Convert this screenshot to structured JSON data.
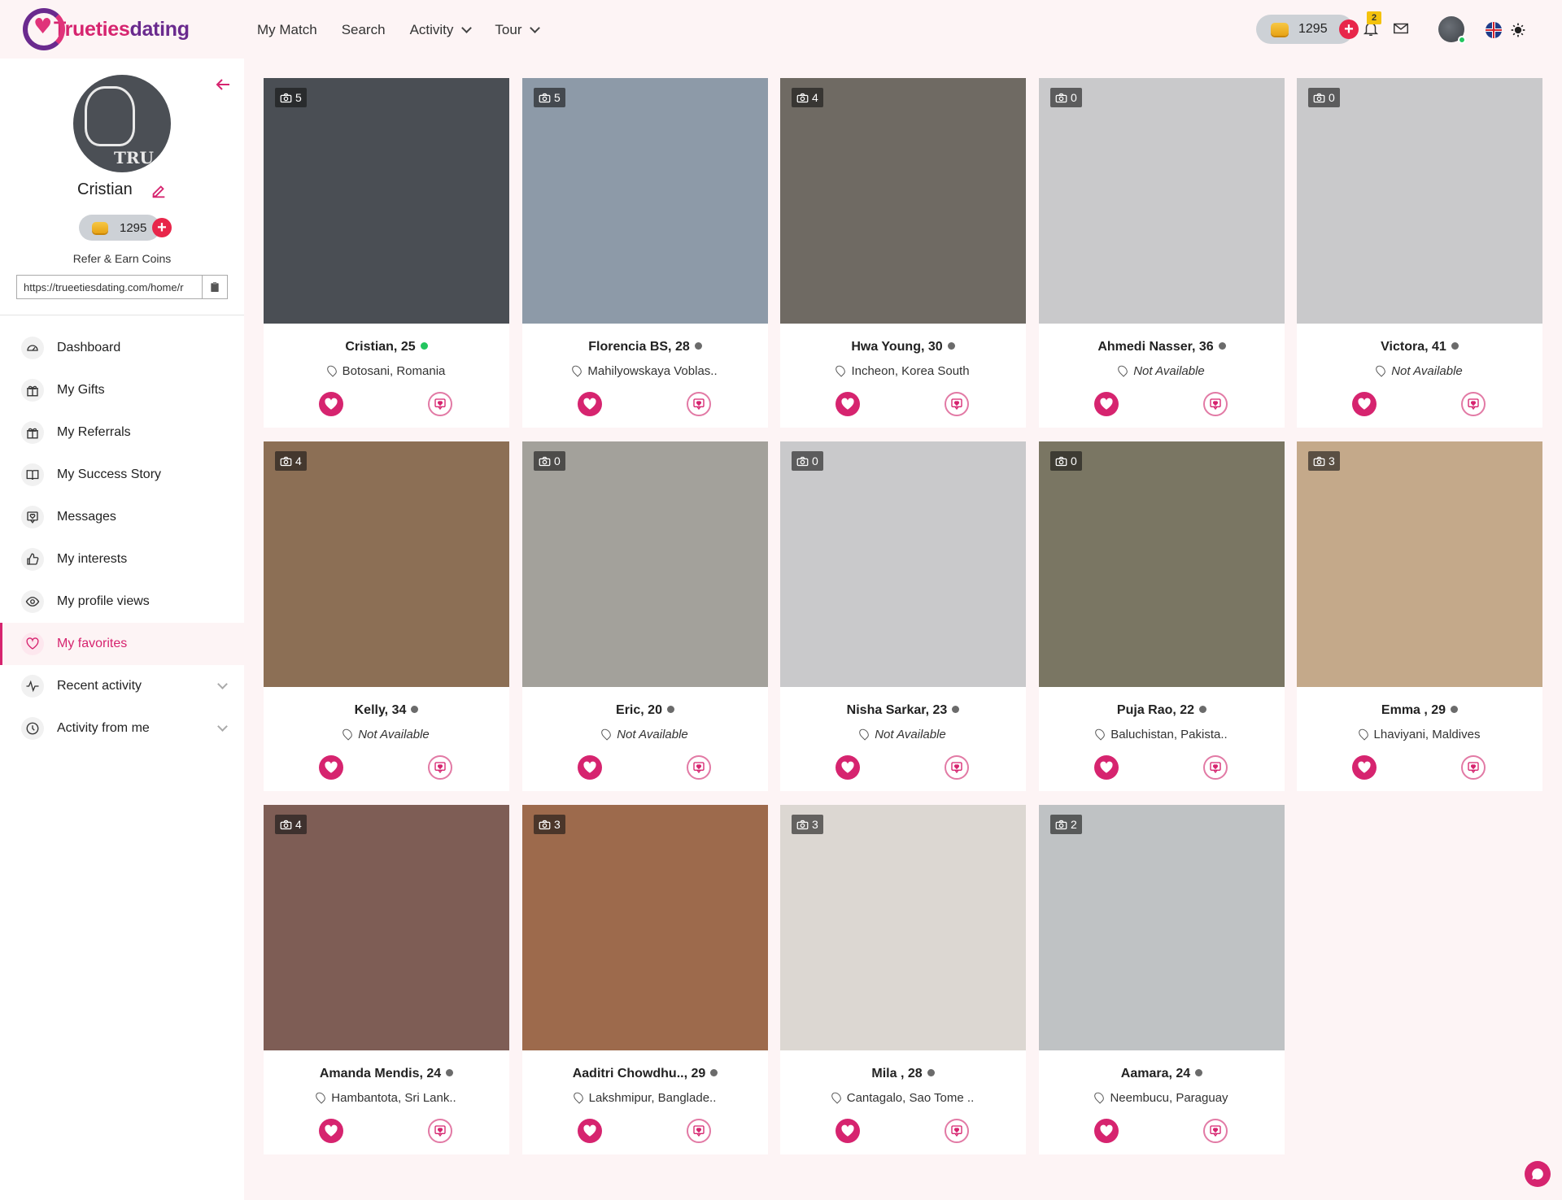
{
  "brand": {
    "name_part1": "Trueties",
    "name_part2": "dating"
  },
  "nav": [
    "My Match",
    "Search",
    "Activity",
    "Tour"
  ],
  "header": {
    "coins": "1295",
    "notifications": "2"
  },
  "profile": {
    "name": "Cristian",
    "coins": "1295",
    "refer_label": "Refer & Earn Coins",
    "refer_link": "https://trueetiesdating.com/home/r"
  },
  "menu": [
    {
      "label": "Dashboard",
      "icon": "dashboard-icon"
    },
    {
      "label": "My Gifts",
      "icon": "gift-icon"
    },
    {
      "label": "My Referrals",
      "icon": "gift-icon"
    },
    {
      "label": "My Success Story",
      "icon": "book-icon"
    },
    {
      "label": "Messages",
      "icon": "message-icon"
    },
    {
      "label": "My interests",
      "icon": "thumbs-up-icon"
    },
    {
      "label": "My profile views",
      "icon": "eye-icon"
    },
    {
      "label": "My favorites",
      "icon": "heart-icon"
    },
    {
      "label": "Recent activity",
      "icon": "activity-icon"
    },
    {
      "label": "Activity from me",
      "icon": "clock-icon"
    }
  ],
  "cards": [
    {
      "name": "Cristian, 25",
      "location": "Botosani, Romania",
      "photos": "5",
      "online": true,
      "bg": "#4a4e54"
    },
    {
      "name": "Florencia BS, 28",
      "location": "Mahilyowskaya Voblas..",
      "photos": "5",
      "online": false,
      "bg": "#8d9aa8"
    },
    {
      "name": "Hwa Young, 30",
      "location": "Incheon, Korea South",
      "photos": "4",
      "online": false,
      "bg": "#6f6a63"
    },
    {
      "name": "Ahmedi Nasser, 36",
      "location": "Not Available",
      "photos": "0",
      "online": false,
      "bg": "#c9c9cb"
    },
    {
      "name": "Victora, 41",
      "location": "Not Available",
      "photos": "0",
      "online": false,
      "bg": "#c9c9cb"
    },
    {
      "name": "Kelly, 34",
      "location": "Not Available",
      "photos": "4",
      "online": false,
      "bg": "#8c6f55"
    },
    {
      "name": "Eric, 20",
      "location": "Not Available",
      "photos": "0",
      "online": false,
      "bg": "#a3a19b"
    },
    {
      "name": "Nisha Sarkar, 23",
      "location": "Not Available",
      "photos": "0",
      "online": false,
      "bg": "#c9c9cb"
    },
    {
      "name": "Puja Rao, 22",
      "location": "Baluchistan, Pakista..",
      "photos": "0",
      "online": false,
      "bg": "#7a7663"
    },
    {
      "name": "Emma , 29",
      "location": "Lhaviyani, Maldives",
      "photos": "3",
      "online": false,
      "bg": "#c4a98a"
    },
    {
      "name": "Amanda Mendis, 24",
      "location": "Hambantota, Sri Lank..",
      "photos": "4",
      "online": false,
      "bg": "#7e5d55"
    },
    {
      "name": "Aaditri Chowdhu.., 29",
      "location": "Lakshmipur, Banglade..",
      "photos": "3",
      "online": false,
      "bg": "#9d6a4c"
    },
    {
      "name": "Mila , 28",
      "location": "Cantagalo, Sao Tome ..",
      "photos": "3",
      "online": false,
      "bg": "#dcd7d2"
    },
    {
      "name": "Aamara, 24",
      "location": "Neembucu, Paraguay",
      "photos": "2",
      "online": false,
      "bg": "#bfc2c4"
    }
  ],
  "colors": {
    "accent": "#d6246f",
    "brand_purple": "#6a2a8e",
    "background": "#fdf4f5"
  }
}
